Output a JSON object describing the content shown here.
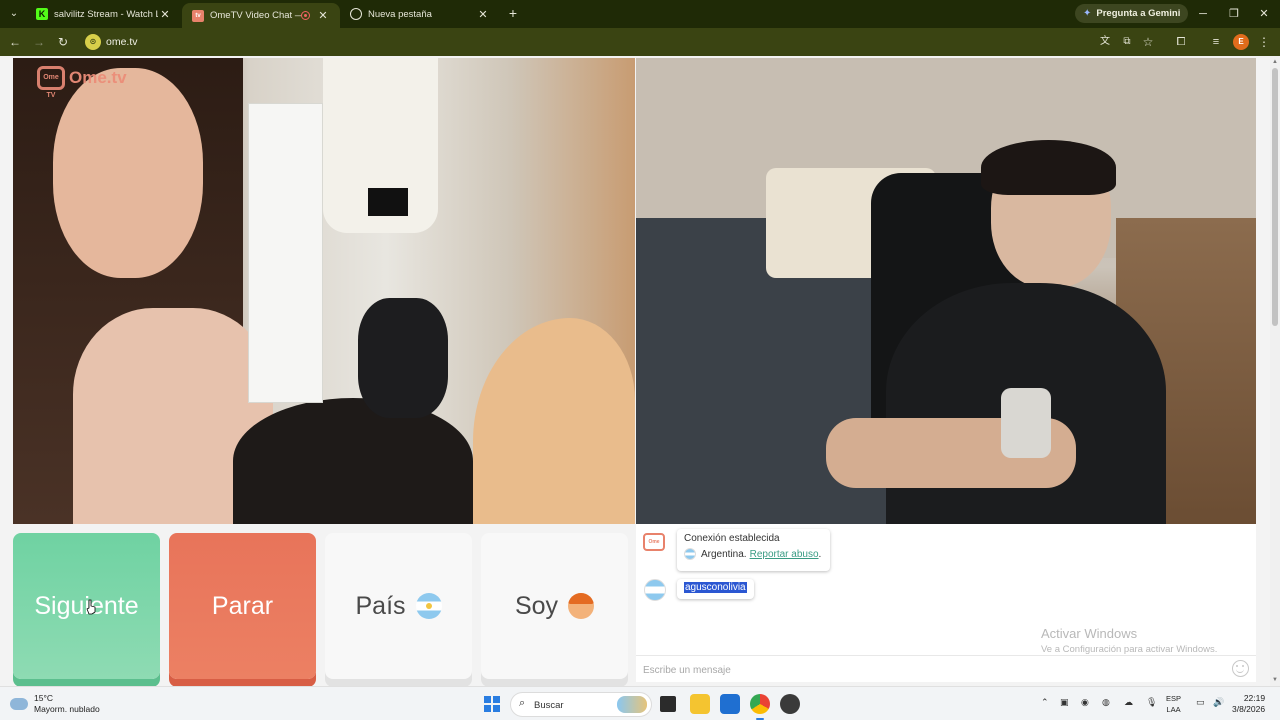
{
  "browser": {
    "tabs": [
      {
        "title": "salvilitz Stream - Watch Live on",
        "favicon": "K"
      },
      {
        "title": "OmeTV Video Chat — Ome",
        "favicon": "tv"
      },
      {
        "title": "Nueva pestaña",
        "favicon": "globe"
      }
    ],
    "gemini_label": "Pregunta a Gemini",
    "url": "ome.tv",
    "profile_initial": "E",
    "colors": {
      "frame": "#1f2a06",
      "toolbar": "#3a4412"
    }
  },
  "page": {
    "logo_text": "Ome.tv",
    "logo_badge": "Ome TV",
    "buttons": {
      "siguiente": "Siguiente",
      "parar": "Parar",
      "pais": "País",
      "soy": "Soy"
    },
    "colors": {
      "siguiente": "#6fd2a2",
      "parar": "#e8745a",
      "link": "#3a9c84"
    }
  },
  "chat": {
    "system_title": "Conexión establecida",
    "country": "Argentina.",
    "report_link": "Reportar abuso",
    "report_suffix": ".",
    "user_message": "agusconolivia",
    "input_placeholder": "Escribe un mensaje",
    "watermark_title": "Activar Windows",
    "watermark_sub": "Ve a Configuración para activar Windows."
  },
  "taskbar": {
    "weather_temp": "15°C",
    "weather_desc": "Mayorm. nublado",
    "search_label": "Buscar",
    "ime_line1": "ESP",
    "ime_line2": "LAA",
    "time": "22:19",
    "date": "3/8/2026"
  }
}
